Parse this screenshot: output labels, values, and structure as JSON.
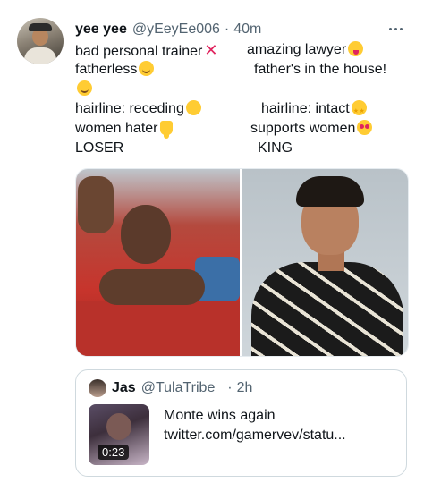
{
  "tweet": {
    "author_name": "yee yee",
    "author_handle": "@yEeyEe006",
    "separator": "·",
    "time": "40m",
    "left_column": [
      "bad personal trainer",
      "fatherless",
      "hairline: receding",
      "women hater",
      "LOSER"
    ],
    "right_column": [
      "amazing lawyer",
      "father's in the house!",
      "hairline: intact",
      "supports women",
      "KING"
    ],
    "icons": {
      "more": "more-options-icon",
      "x": "red-x-emoji",
      "blush": "smiling-face-emoji",
      "tongue": "tongue-out-emoji",
      "cry": "crying-face-emoji",
      "star": "star-struck-emoji",
      "thumb": "thumbs-down-emoji",
      "hearts": "heart-eyes-emoji"
    }
  },
  "quoted_tweet": {
    "author_name": "Jas",
    "author_handle": "@TulaTribe_",
    "separator": "·",
    "time": "2h",
    "video_duration": "0:23",
    "text_line1": "Monte wins again",
    "text_line2": "twitter.com/gamervev/statu..."
  },
  "colors": {
    "text": "#0f1419",
    "muted": "#536471",
    "border": "#cfd9de",
    "emoji_x": "#e0245e"
  }
}
